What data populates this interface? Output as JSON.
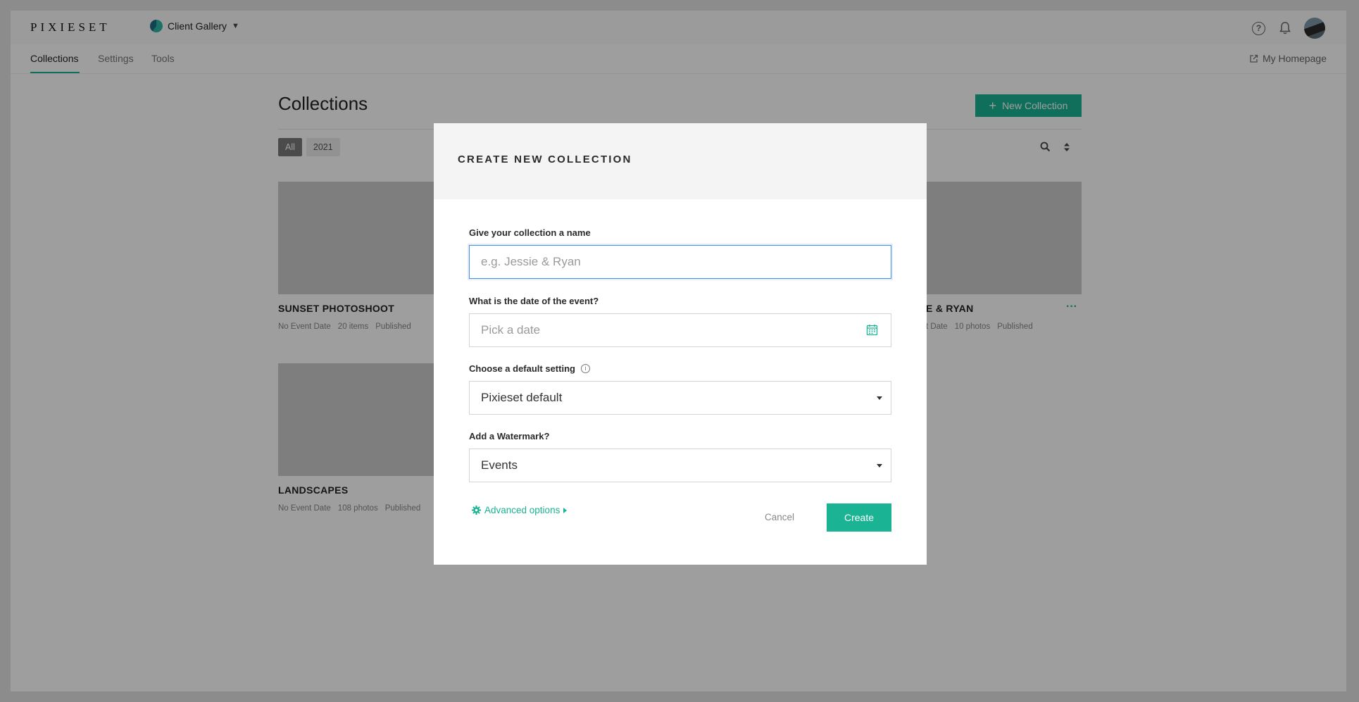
{
  "app": {
    "logo": "PIXIESET",
    "gallery_switch": "Client Gallery"
  },
  "nav": {
    "tabs": [
      "Collections",
      "Settings",
      "Tools"
    ],
    "homepage_link": "My Homepage"
  },
  "page": {
    "title": "Collections",
    "new_collection": "New Collection",
    "filters": [
      "All",
      "2021"
    ],
    "cards": [
      {
        "title": "SUNSET PHOTOSHOOT",
        "date": "No Event Date",
        "count": "20 items",
        "status": "Published"
      },
      {
        "title": "E & RYAN",
        "date": "t Date",
        "count": "10 photos",
        "status": "Published"
      },
      {
        "title": "LANDSCAPES",
        "date": "No Event Date",
        "count": "108 photos",
        "status": "Published"
      }
    ]
  },
  "modal": {
    "title": "CREATE NEW COLLECTION",
    "name_label": "Give your collection a name",
    "name_placeholder": "e.g. Jessie & Ryan",
    "date_label": "What is the date of the event?",
    "date_placeholder": "Pick a date",
    "setting_label": "Choose a default setting",
    "setting_value": "Pixieset default",
    "watermark_label": "Add a Watermark?",
    "watermark_value": "Events",
    "advanced_options": "Advanced options",
    "cancel": "Cancel",
    "create": "Create"
  },
  "colors": {
    "accent": "#1ab394",
    "focus_border": "#4a90e2"
  }
}
